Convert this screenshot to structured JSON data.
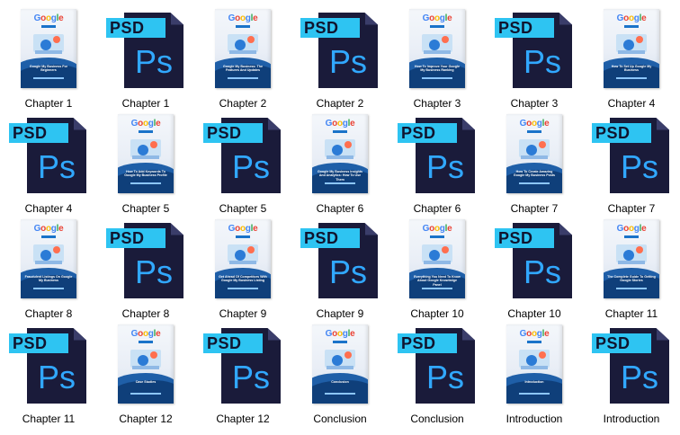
{
  "items": [
    {
      "label": "Chapter 1",
      "type": "cover",
      "cover_title": "Google My Business For Beginners"
    },
    {
      "label": "Chapter 1",
      "type": "psd",
      "badge": "PSD",
      "glyph": "Ps"
    },
    {
      "label": "Chapter 2",
      "type": "cover",
      "cover_title": "Google My Business: The Features And Updates"
    },
    {
      "label": "Chapter 2",
      "type": "psd",
      "badge": "PSD",
      "glyph": "Ps"
    },
    {
      "label": "Chapter 3",
      "type": "cover",
      "cover_title": "How To Improve Your Google My Business Ranking"
    },
    {
      "label": "Chapter 3",
      "type": "psd",
      "badge": "PSD",
      "glyph": "Ps"
    },
    {
      "label": "Chapter 4",
      "type": "cover",
      "cover_title": "How To Set Up Google My Business"
    },
    {
      "label": "Chapter 4",
      "type": "psd",
      "badge": "PSD",
      "glyph": "Ps"
    },
    {
      "label": "Chapter 5",
      "type": "cover",
      "cover_title": "How To Add Keywords To Google My Business Profile"
    },
    {
      "label": "Chapter 5",
      "type": "psd",
      "badge": "PSD",
      "glyph": "Ps"
    },
    {
      "label": "Chapter 6",
      "type": "cover",
      "cover_title": "Google My Business Insights And Analytics: How To Use Them"
    },
    {
      "label": "Chapter 6",
      "type": "psd",
      "badge": "PSD",
      "glyph": "Ps"
    },
    {
      "label": "Chapter 7",
      "type": "cover",
      "cover_title": "How To Create Amazing Google My Business Posts"
    },
    {
      "label": "Chapter 7",
      "type": "psd",
      "badge": "PSD",
      "glyph": "Ps"
    },
    {
      "label": "Chapter 8",
      "type": "cover",
      "cover_title": "Fraudulent Listings On Google My Business"
    },
    {
      "label": "Chapter 8",
      "type": "psd",
      "badge": "PSD",
      "glyph": "Ps"
    },
    {
      "label": "Chapter 9",
      "type": "cover",
      "cover_title": "Get Ahead Of Competitors With Google My Business Listing"
    },
    {
      "label": "Chapter 9",
      "type": "psd",
      "badge": "PSD",
      "glyph": "Ps"
    },
    {
      "label": "Chapter 10",
      "type": "cover",
      "cover_title": "Everything You Need To Know About Google Knowledge Panel"
    },
    {
      "label": "Chapter 10",
      "type": "psd",
      "badge": "PSD",
      "glyph": "Ps"
    },
    {
      "label": "Chapter 11",
      "type": "cover",
      "cover_title": "The Complete Guide To Getting Google Stories"
    },
    {
      "label": "Chapter 11",
      "type": "psd",
      "badge": "PSD",
      "glyph": "Ps"
    },
    {
      "label": "Chapter 12",
      "type": "cover",
      "cover_title": "Case Studies"
    },
    {
      "label": "Chapter 12",
      "type": "psd",
      "badge": "PSD",
      "glyph": "Ps"
    },
    {
      "label": "Conclusion",
      "type": "cover",
      "cover_title": "Conclusion"
    },
    {
      "label": "Conclusion",
      "type": "psd",
      "badge": "PSD",
      "glyph": "Ps"
    },
    {
      "label": "Introduction",
      "type": "cover",
      "cover_title": "Introduction"
    },
    {
      "label": "Introduction",
      "type": "psd",
      "badge": "PSD",
      "glyph": "Ps"
    }
  ],
  "logo_letters": [
    "G",
    "o",
    "o",
    "g",
    "l",
    "e"
  ]
}
